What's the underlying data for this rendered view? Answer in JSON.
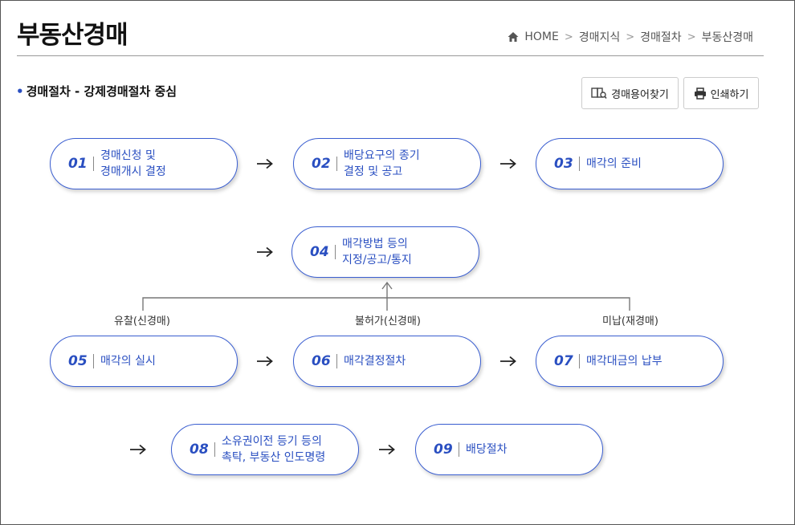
{
  "page": {
    "title": "부동산경매"
  },
  "breadcrumb": [
    "HOME",
    "경매지식",
    "경매절차",
    "부동산경매"
  ],
  "section": {
    "title": "경매절차 - 강제경매절차 중심"
  },
  "toolbar": {
    "glossary_label": "경매용어찾기",
    "print_label": "인쇄하기"
  },
  "steps": [
    {
      "num": "01",
      "label": "경매신청 및\n경매개시 결정"
    },
    {
      "num": "02",
      "label": "배당요구의 종기\n결정 및 공고"
    },
    {
      "num": "03",
      "label": "매각의 준비"
    },
    {
      "num": "04",
      "label": "매각방법 등의\n지정/공고/통지"
    },
    {
      "num": "05",
      "label": "매각의 실시"
    },
    {
      "num": "06",
      "label": "매각결정절차"
    },
    {
      "num": "07",
      "label": "매각대금의 납부"
    },
    {
      "num": "08",
      "label": "소유권이전 등기 등의\n촉탁, 부동산 인도명령"
    },
    {
      "num": "09",
      "label": "배당절차"
    }
  ],
  "branches": {
    "left": "유찰(신경매)",
    "middle": "불허가(신경매)",
    "right": "미납(재경매)"
  },
  "colors": {
    "accent": "#2a4fc1",
    "border": "#3b5fd1"
  }
}
